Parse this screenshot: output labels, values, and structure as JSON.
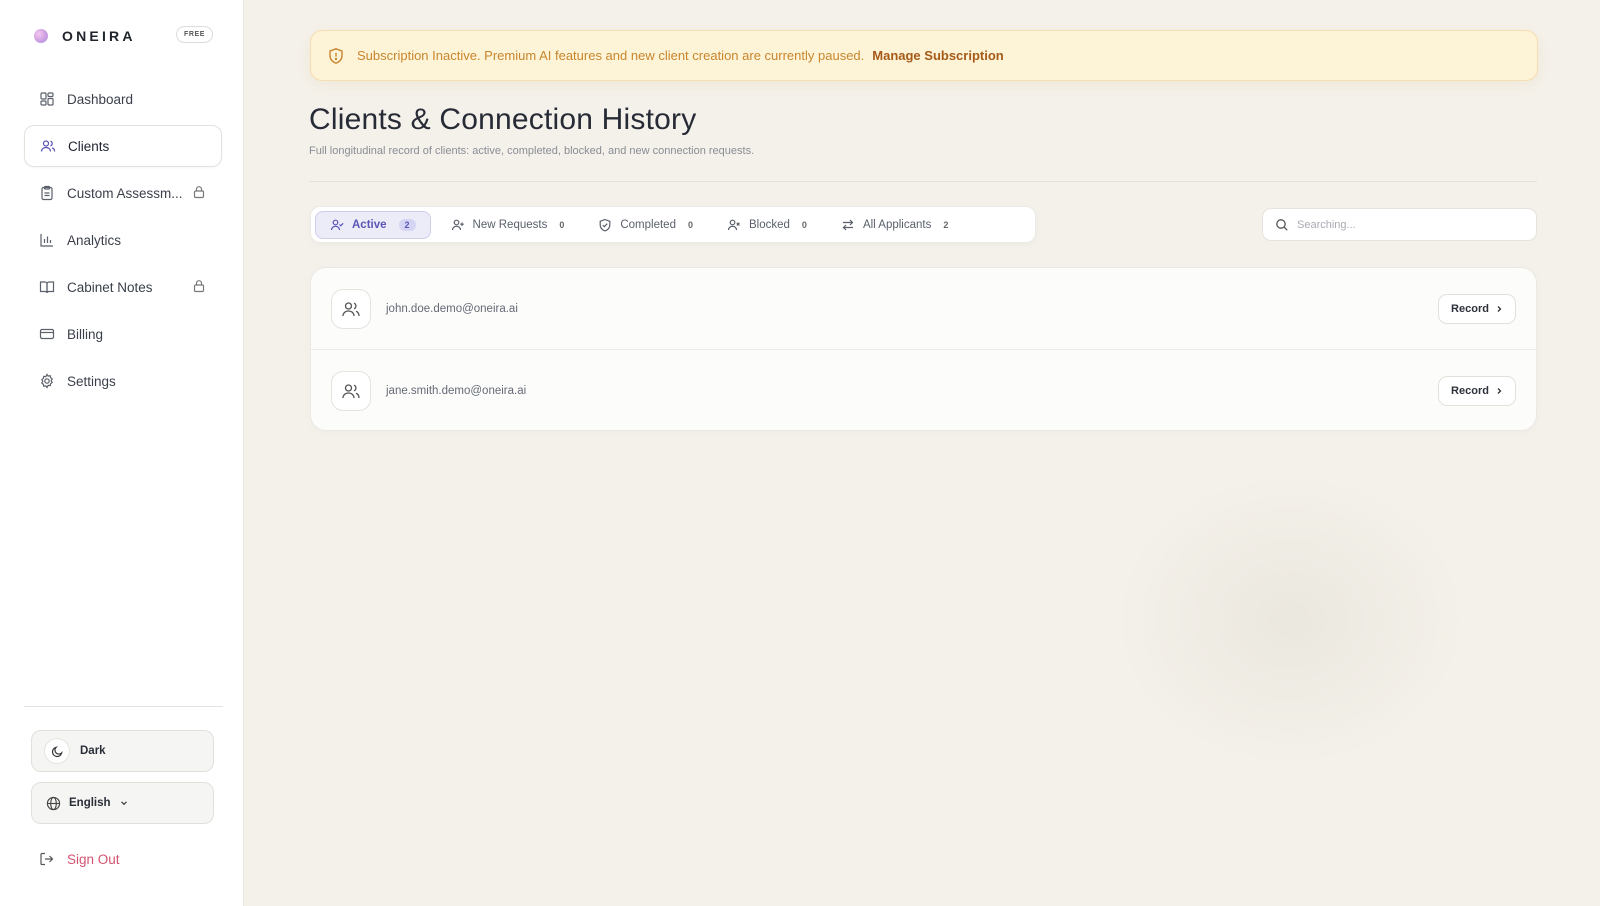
{
  "brand": {
    "name": "ONEIRA",
    "plan_badge": "FREE"
  },
  "sidebar": {
    "items": [
      {
        "label": "Dashboard",
        "icon": "dashboard-grid-icon"
      },
      {
        "label": "Clients",
        "icon": "users-icon",
        "active": true
      },
      {
        "label": "Custom Assessm...",
        "icon": "clipboard-icon",
        "locked": true
      },
      {
        "label": "Analytics",
        "icon": "bar-chart-icon"
      },
      {
        "label": "Cabinet Notes",
        "icon": "book-icon",
        "locked": true
      },
      {
        "label": "Billing",
        "icon": "credit-card-icon"
      },
      {
        "label": "Settings",
        "icon": "gear-icon"
      }
    ],
    "theme_label": "Dark",
    "language_label": "English",
    "signout_label": "Sign Out"
  },
  "banner": {
    "text": "Subscription Inactive. Premium AI features and new client creation are currently paused.",
    "link": "Manage Subscription"
  },
  "page": {
    "title": "Clients & Connection History",
    "subtitle": "Full longitudinal record of clients: active, completed, blocked, and new connection requests."
  },
  "tabs": [
    {
      "label": "Active",
      "count": "2",
      "icon": "user-check-icon",
      "active": true
    },
    {
      "label": "New Requests",
      "count": "0",
      "icon": "user-plus-icon"
    },
    {
      "label": "Completed",
      "count": "0",
      "icon": "shield-check-icon"
    },
    {
      "label": "Blocked",
      "count": "0",
      "icon": "user-x-icon"
    },
    {
      "label": "All Applicants",
      "count": "2",
      "icon": "swap-arrows-icon"
    }
  ],
  "search": {
    "placeholder": "Searching..."
  },
  "clients": [
    {
      "email": "john.doe.demo@oneira.ai",
      "action": "Record"
    },
    {
      "email": "jane.smith.demo@oneira.ai",
      "action": "Record"
    }
  ],
  "colors": {
    "accent": "#5a56b6",
    "warning_bg": "#fdf3d7",
    "warning_text": "#c8862d",
    "signout": "#d4546f"
  }
}
